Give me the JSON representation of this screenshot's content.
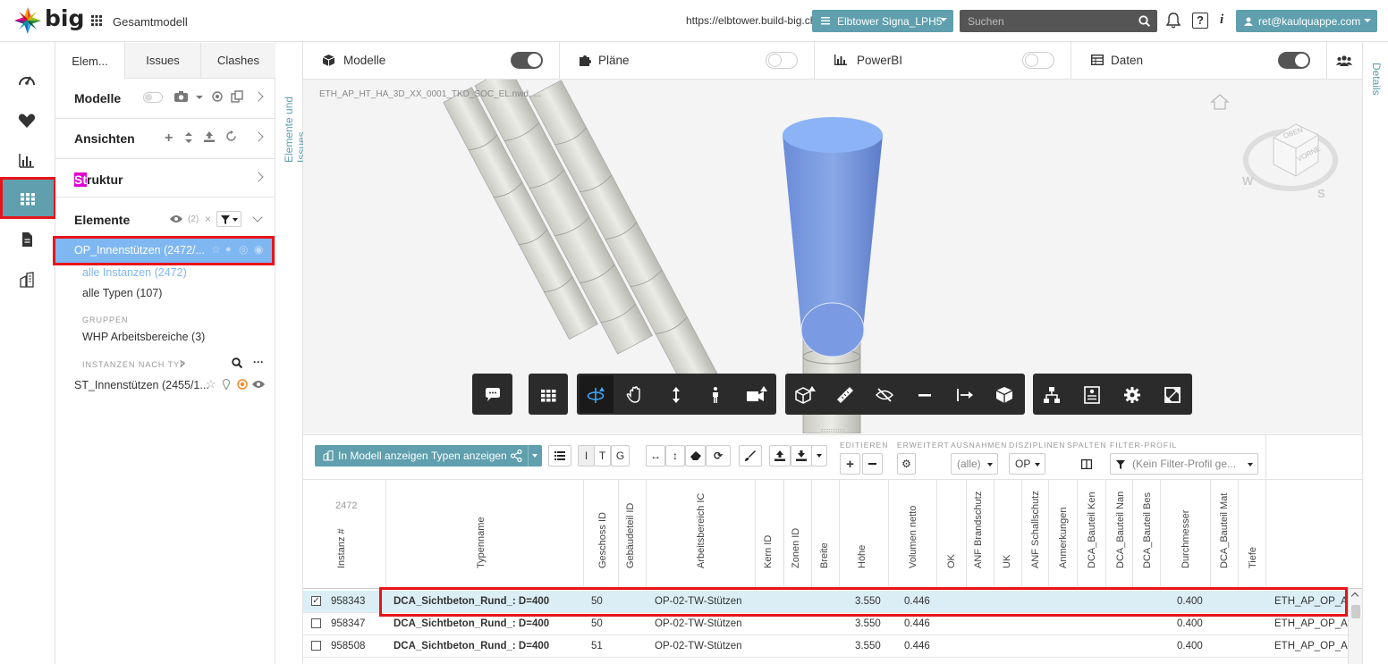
{
  "header": {
    "brand": "big",
    "project_title": "Gesamtmodell",
    "url": "https://elbtower.build-big.ch",
    "project_selector": "Elbtower Signa_LPH5",
    "search_placeholder": "Suchen",
    "help": "?",
    "info": "i",
    "user": "ret@kaulquappe.com"
  },
  "colors": {
    "accent": "#5f9fae",
    "highlight": "#e8141b",
    "selection": "#7fb7f2"
  },
  "rail_icons": [
    "dashboard-icon",
    "heart-icon",
    "chart-icon",
    "grid-icon",
    "document-icon",
    "building-icon"
  ],
  "panel": {
    "tabs": [
      "Elem...",
      "Issues",
      "Clashes"
    ],
    "modelle": "Modelle",
    "ansichten": "Ansichten",
    "struktur_hl": "St",
    "struktur_rest": "ruktur",
    "elemente": "Elemente",
    "elemente_count": "(2)",
    "selected_item": "OP_Innenstützen (2472/...",
    "sub1": "alle Instanzen (2472)",
    "sub2": "alle Typen (107)",
    "group_label": "GRUPPEN",
    "group_item": "WHP Arbeitsbereiche (3)",
    "instances_label": "INSTANZEN NACH TYP",
    "instance_item": "ST_Innenstützen (2455/1..."
  },
  "vertical_labels": {
    "left": "Elemente und Issues",
    "right": "Details"
  },
  "toggles": [
    {
      "label": "Modelle",
      "on": true
    },
    {
      "label": "Pläne",
      "on": false
    },
    {
      "label": "PowerBI",
      "on": false
    },
    {
      "label": "Daten",
      "on": true
    }
  ],
  "viewport": {
    "file": "ETH_AP_HT_HA_3D_XX_0001_TKD_SOC_EL.nwd, ...",
    "cube_top": "OBEN",
    "cube_front": "VORNE",
    "compass_w": "W",
    "compass_s": "S"
  },
  "bottom_toolbar": {
    "show_in_model": "In Modell anzeigen",
    "show_types": "Typen anzeigen",
    "i": "I",
    "t": "T",
    "g": "G",
    "group_edit": "EDITIEREN",
    "group_ext": "ERWEITERT",
    "group_exc": "AUSNAHMEN",
    "group_disc": "DISZIPLINEN",
    "group_cols": "SPALTEN",
    "group_filter": "FILTER-PROFIL",
    "exc_value": "(alle)",
    "disc_value": "OP",
    "filter_value": "(Kein Filter-Profil ge..."
  },
  "table": {
    "count": "2472",
    "columns": [
      "Instanz #",
      "Typenname",
      "Geschoss ID",
      "Gebäudeteil ID",
      "Arbeitsbereich IC",
      "Kern ID",
      "Zonen ID",
      "Breite",
      "Höhe",
      "Volumen netto",
      "OK",
      "ANF Brandschutz",
      "UK",
      "ANF Schallschutz",
      "Anmerkungen",
      "DCA_Bauteil Ken",
      "DCA_Bauteil Nan",
      "DCA_Bauteil Bes",
      "Durchmesser",
      "DCA_Bauteil Mat",
      "Tiefe"
    ],
    "rows": [
      {
        "checked": true,
        "id": "958343",
        "type": "DCA_Sichtbeton_Rund_: D=400",
        "geschoss": "50",
        "arbeitsbereich": "OP-02-TW-Stützen",
        "hoehe": "3.550",
        "volumen": "0.446",
        "durchmesser": "0.400",
        "last": "ETH_AP_OP_AR"
      },
      {
        "checked": false,
        "id": "958347",
        "type": "DCA_Sichtbeton_Rund_: D=400",
        "geschoss": "50",
        "arbeitsbereich": "OP-02-TW-Stützen",
        "hoehe": "3.550",
        "volumen": "0.446",
        "durchmesser": "0.400",
        "last": "ETH_AP_OP_AR"
      },
      {
        "checked": false,
        "id": "958508",
        "type": "DCA_Sichtbeton_Rund_: D=400",
        "geschoss": "51",
        "arbeitsbereich": "OP-02-TW-Stützen",
        "hoehe": "3.550",
        "volumen": "0.446",
        "durchmesser": "0.400",
        "last": "ETH_AP_OP_AR"
      }
    ]
  }
}
